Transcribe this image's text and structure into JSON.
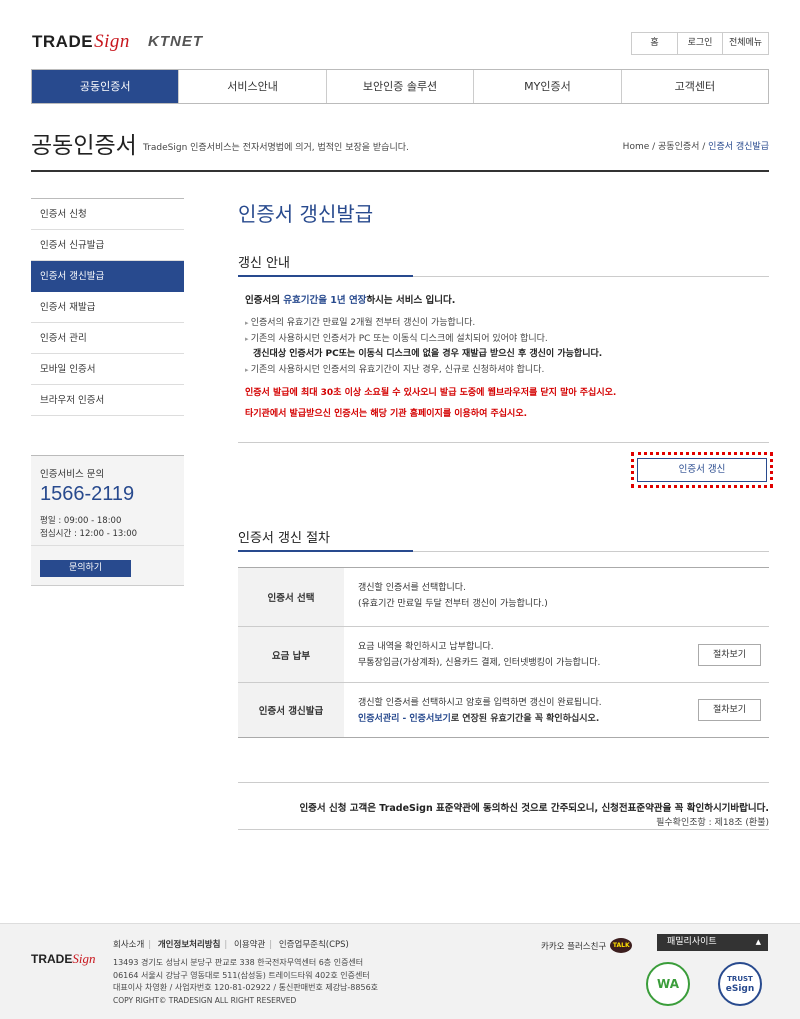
{
  "header": {
    "logo_trade": "TRADE",
    "logo_sign": "Sign",
    "logo_ktnet": "KTNET",
    "util": [
      "홈",
      "로그인",
      "전체메뉴"
    ]
  },
  "gnb": [
    "공동인증서",
    "서비스안내",
    "보안인증 솔루션",
    "MY인증서",
    "고객센터"
  ],
  "page": {
    "title": "공동인증서",
    "desc": "TradeSign 인증서비스는 전자서명법에 의거, 법적인 보장을 받습니다.",
    "crumb_prefix": "Home / 공동인증서 / ",
    "crumb_current": "인증서 갱신발급"
  },
  "lnb": [
    "인증서 신청",
    "인증서 신규발급",
    "인증서 갱신발급",
    "인증서 재발급",
    "인증서 관리",
    "모바일 인증서",
    "브라우저 인증서"
  ],
  "contact": {
    "title": "인증서비스 문의",
    "number": "1566-2119",
    "hours1": "평일 : 09:00 - 18:00",
    "hours2": "점심시간 : 12:00 - 13:00",
    "button": "문의하기"
  },
  "main": {
    "title": "인증서 갱신발급",
    "sec1": "갱신 안내",
    "intro_a": "인증서의 ",
    "intro_b": "유효기간을 1년 연장",
    "intro_c": "하시는 서비스 입니다.",
    "b1": "인증서의 유효기간 만료일 2개월 전부터 갱신이 가능합니다.",
    "b2": "기존의 사용하시던 인증서가 PC 또는 이동식 디스크에 설치되어 있어야 합니다.",
    "b2_strong": "갱신대상 인증서가 PC또는 이동식 디스크에 없을 경우 재발급 받으신 후 갱신이 가능합니다.",
    "b3": "기존의 사용하시던 인증서의 유효기간이 지난 경우, 신규로 신청하셔야 합니다.",
    "warn1": "인증서 발급에 최대 30초 이상 소요될 수 있사오니 발급 도중에 웹브라우저를 닫지 말아 주십시오.",
    "warn2": "타기관에서 발급받으신 인증서는 해당 기관 홈페이지를 이용하여 주십시오.",
    "renew_button": "인증서 갱신",
    "sec2": "인증서 갱신 절차"
  },
  "steps": [
    {
      "label": "인증서 선택",
      "l1": "갱신할 인증서를 선택합니다.",
      "l2": "(유효기간 만료일 두달 전부터 갱신이 가능합니다.)",
      "btn": ""
    },
    {
      "label": "요금 납부",
      "l1": "요금 내역을 확인하시고 납부합니다.",
      "l2": "무통장입금(가상계좌), 신용카드 결제, 인터넷뱅킹이 가능합니다.",
      "btn": "절차보기"
    },
    {
      "label": "인증서 갱신발급",
      "l1": "갱신할 인증서를 선택하시고 암호를 입력하면 갱신이 완료됩니다.",
      "l2a": "인증서관리 - 인증서보기",
      "l2b": "로 연장된 유효기간을 꼭 확인하십시오.",
      "btn": "절차보기"
    }
  ],
  "notice": {
    "line1": "인증서 신청 고객은 TradeSign 표준약관에 동의하신 것으로 간주되오니, 신청전표준약관을 꼭 확인하시기바랍니다.",
    "line2": "필수확인조항 : 제18조 (환불)"
  },
  "footer": {
    "links": [
      "회사소개",
      "개인정보처리방침",
      "이용약관",
      "인증업무준칙(CPS)"
    ],
    "addr1": "13493 경기도 성남시 분당구 판교로 338 한국전자무역센터 6층 인증센터",
    "addr2": "06164 서울시 강남구 영동대로 511(삼성동) 트레이드타워 402호 인증센터",
    "addr3": "대표이사 차영환 / 사업자번호 120-81-02922 / 통신판매번호 제강남-8856호",
    "copy": "COPY RIGHT© TRADESIGN ALL RIGHT RESERVED",
    "kakao": "카카오 플러스친구",
    "talk": "TALK",
    "family": "패밀리사이트",
    "badge1": "WA",
    "badge2a": "TRUST",
    "badge2b": "eSign"
  },
  "colors": {
    "accent": "#284a8e",
    "warn": "#d40000",
    "brand_red": "#c8161d"
  }
}
